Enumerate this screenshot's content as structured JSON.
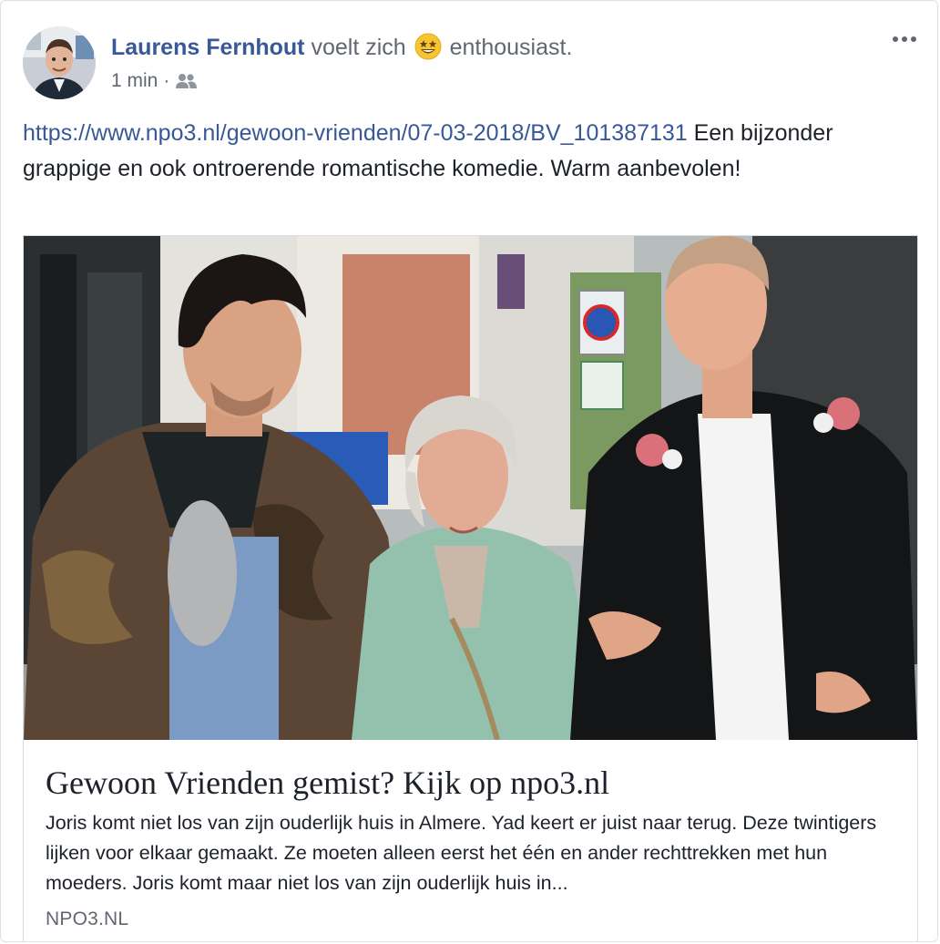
{
  "post": {
    "author": "Laurens Fernhout",
    "feeling_prefix": "voelt zich",
    "feeling": "enthousiast.",
    "feeling_icon": "star-struck-emoji-icon",
    "timestamp": "1 min",
    "separator": "·",
    "audience_icon": "friends-icon",
    "more_icon": "more-options-icon",
    "link_url": "https://www.npo3.nl/gewoon-vrienden/07-03-2018/BV_101387131",
    "text": " Een bijzonder grappige en ook ontroerende romantische komedie. Warm aanbevolen!"
  },
  "link_preview": {
    "title": "Gewoon Vrienden gemist? Kijk op npo3.nl",
    "description": "Joris komt niet los van zijn ouderlijk huis in Almere. Yad keert er juist naar terug. Deze twintigers lijken voor elkaar gemaakt. Ze moeten alleen eerst het één en ander rechttrekken met hun moeders. Joris komt maar niet los van zijn ouderlijk huis in...",
    "domain": "NPO3.NL"
  },
  "colors": {
    "link": "#385898",
    "secondary_text": "#616770",
    "border": "#dddfe2"
  }
}
